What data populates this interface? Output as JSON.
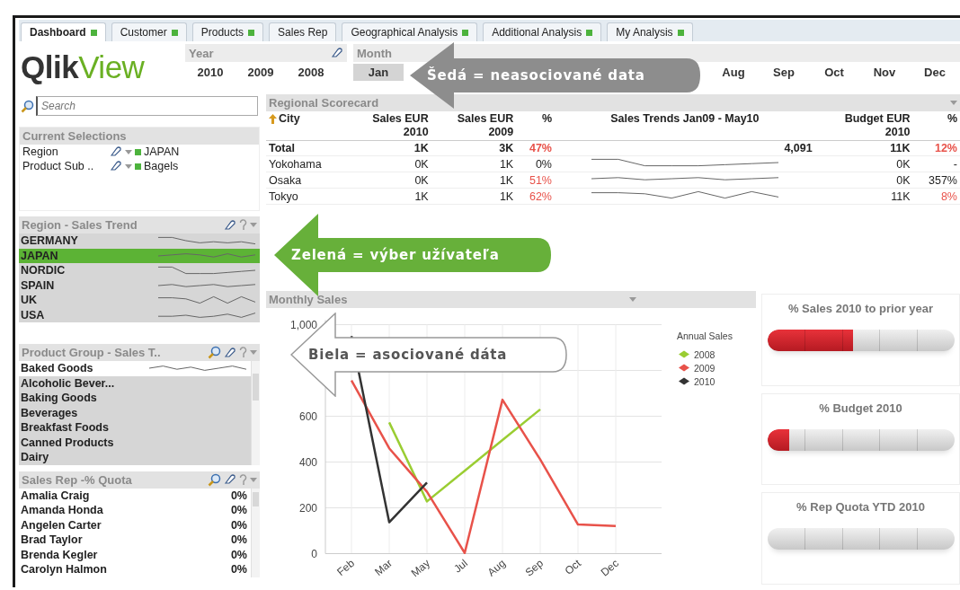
{
  "tabs": [
    {
      "label": "Dashboard",
      "selected": true,
      "indicator": true
    },
    {
      "label": "Customer",
      "selected": false,
      "indicator": true
    },
    {
      "label": "Products",
      "selected": false,
      "indicator": true
    },
    {
      "label": "Sales Rep",
      "selected": false,
      "indicator": false
    },
    {
      "label": "Geographical Analysis",
      "selected": false,
      "indicator": true
    },
    {
      "label": "Additional Analysis",
      "selected": false,
      "indicator": true
    },
    {
      "label": "My Analysis",
      "selected": false,
      "indicator": true
    }
  ],
  "logo": "**Qlik**View",
  "year": {
    "title": "Year",
    "items": [
      {
        "label": "2010",
        "excluded": false
      },
      {
        "label": "2009",
        "excluded": false
      },
      {
        "label": "2008",
        "excluded": false
      }
    ]
  },
  "month": {
    "title": "Month",
    "items": [
      {
        "label": "Jan",
        "excluded": true
      },
      {
        "label": "Aug",
        "excluded": false
      },
      {
        "label": "Sep",
        "excluded": false
      },
      {
        "label": "Oct",
        "excluded": false
      },
      {
        "label": "Nov",
        "excluded": false
      },
      {
        "label": "Dec",
        "excluded": false
      }
    ]
  },
  "search": {
    "placeholder": "Search"
  },
  "current_selections": {
    "title": "Current Selections",
    "rows": [
      {
        "field": "Region",
        "value": "JAPAN"
      },
      {
        "field": "Product Sub ..",
        "value": "Bagels"
      }
    ]
  },
  "region_list": {
    "title": "Region - Sales Trend",
    "items": [
      {
        "label": "GERMANY",
        "selected": false
      },
      {
        "label": "JAPAN",
        "selected": true
      },
      {
        "label": "NORDIC",
        "selected": false
      },
      {
        "label": "SPAIN",
        "selected": false
      },
      {
        "label": "UK",
        "selected": false
      },
      {
        "label": "USA",
        "selected": false
      }
    ]
  },
  "product_group_list": {
    "title": "Product Group - Sales T..",
    "items": [
      {
        "label": "Baked Goods",
        "excluded": false
      },
      {
        "label": "Alcoholic Bever...",
        "excluded": true
      },
      {
        "label": "Baking Goods",
        "excluded": true
      },
      {
        "label": "Beverages",
        "excluded": true
      },
      {
        "label": "Breakfast Foods",
        "excluded": true
      },
      {
        "label": "Canned Products",
        "excluded": true
      },
      {
        "label": "Dairy",
        "excluded": true
      }
    ]
  },
  "sales_rep_list": {
    "title": "Sales Rep -% Quota",
    "items": [
      {
        "name": "Amalia Craig",
        "value": "0%"
      },
      {
        "name": "Amanda Honda",
        "value": "0%"
      },
      {
        "name": "Angelen Carter",
        "value": "0%"
      },
      {
        "name": "Brad Taylor",
        "value": "0%"
      },
      {
        "name": "Brenda Kegler",
        "value": "0%"
      },
      {
        "name": "Carolyn Halmon",
        "value": "0%"
      }
    ]
  },
  "scorecard": {
    "title": "Regional Scorecard",
    "columns": [
      "City",
      "Sales EUR\n2010",
      "Sales EUR\n2009",
      "%",
      "Sales Trends Jan09 - May10",
      "Budget EUR\n2010",
      "%"
    ],
    "rows": [
      {
        "kind": "total",
        "city": "Total",
        "sales_2010": "1K",
        "sales_2009": "3K",
        "change": {
          "text": "47%",
          "alert": true
        },
        "trend": "4,091",
        "budget": "11K",
        "budget_pct": {
          "text": "12%",
          "alert": true
        }
      },
      {
        "kind": "city",
        "city": "Yokohama",
        "sales_2010": "0K",
        "sales_2009": "1K",
        "change": {
          "text": "0%",
          "alert": false
        },
        "budget": "0K",
        "budget_pct": {
          "text": "-",
          "alert": false
        }
      },
      {
        "kind": "city",
        "city": "Osaka",
        "sales_2010": "0K",
        "sales_2009": "1K",
        "change": {
          "text": "51%",
          "alert": true
        },
        "budget": "0K",
        "budget_pct": {
          "text": "357%",
          "alert": false
        }
      },
      {
        "kind": "city",
        "city": "Tokyo",
        "sales_2010": "1K",
        "sales_2009": "1K",
        "change": {
          "text": "62%",
          "alert": true
        },
        "budget": "11K",
        "budget_pct": {
          "text": "8%",
          "alert": true
        }
      }
    ]
  },
  "monthly_sales": {
    "title": "Monthly Sales",
    "legend_title": "Annual Sales",
    "chart_data": {
      "type": "line",
      "categories": [
        "Feb",
        "Mar",
        "May",
        "Jul",
        "Aug",
        "Sep",
        "Oct",
        "Dec"
      ],
      "ylim": [
        0,
        1000
      ],
      "yticks": [
        0,
        200,
        400,
        600,
        {
          "value": 1000,
          "label": "1,000"
        }
      ],
      "grid": true,
      "legend": true,
      "series": [
        {
          "name": "2008",
          "color": "#9acd32",
          "values": [
            null,
            573,
            228,
            362,
            496,
            630,
            null,
            null
          ]
        },
        {
          "name": "2009",
          "color": "#e8524a",
          "values": [
            756,
            460,
            270,
            3,
            672,
            411,
            127,
            121
          ]
        },
        {
          "name": "2010",
          "color": "#333333",
          "values": [
            950,
            137,
            310,
            null,
            null,
            null,
            null,
            null
          ]
        }
      ]
    }
  },
  "gauges": [
    {
      "title": "% Sales 2010 to prior year",
      "level": 0.46
    },
    {
      "title": "% Budget 2010",
      "level": 0.12
    },
    {
      "title": "% Rep Quota YTD 2010"
    }
  ],
  "callouts": [
    {
      "kind": "gray",
      "text": "Šedá = neasociované data"
    },
    {
      "kind": "green",
      "text": "Zelená = výber užívateľa"
    },
    {
      "kind": "white",
      "text": "Biela = asociované dáta"
    }
  ]
}
